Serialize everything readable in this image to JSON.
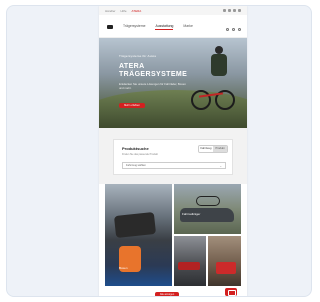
{
  "topbar": {
    "items": [
      "Händler",
      "Hilfe",
      "ATERA"
    ]
  },
  "nav": {
    "links": [
      "Trägersysteme",
      "Ausstattung",
      "Marke"
    ]
  },
  "hero": {
    "kicker": "Trägersysteme für Autos",
    "title": "ATERA TRÄGERSYSTEME",
    "subtitle": "Entdecken Sie unsere Lösungen für Fahrräder, Boxen und mehr.",
    "button": "Mehr erfahren"
  },
  "configurator": {
    "title": "Produktsuche",
    "text": "Finden Sie das passende Produkt",
    "toggle_on": "Fahrzeug",
    "toggle_off": "Produkt",
    "select_placeholder": "Fahrzeug wählen"
  },
  "gallery": {
    "tile1_label": "Boxen",
    "tile2_label": "Fahrradträger"
  },
  "footer": {
    "button": "Alle anzeigen"
  }
}
